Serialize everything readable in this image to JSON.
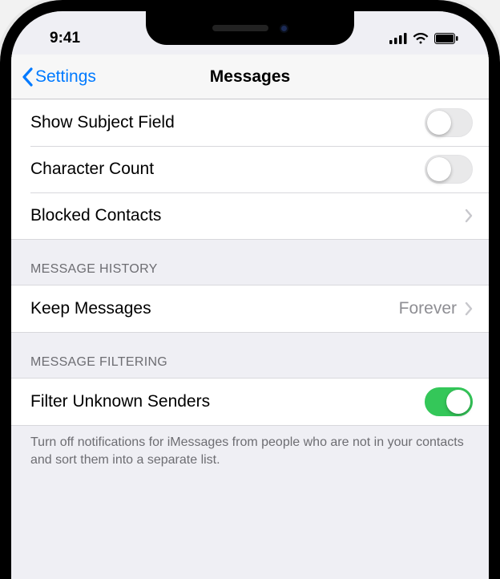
{
  "status": {
    "time": "9:41"
  },
  "nav": {
    "back_label": "Settings",
    "title": "Messages"
  },
  "sections": {
    "general": {
      "show_subject": {
        "label": "Show Subject Field",
        "on": false
      },
      "char_count": {
        "label": "Character Count",
        "on": false
      },
      "blocked": {
        "label": "Blocked Contacts"
      }
    },
    "history": {
      "header": "MESSAGE HISTORY",
      "keep": {
        "label": "Keep Messages",
        "value": "Forever"
      }
    },
    "filtering": {
      "header": "MESSAGE FILTERING",
      "filter_unknown": {
        "label": "Filter Unknown Senders",
        "on": true
      },
      "footer": "Turn off notifications for iMessages from people who are not in your contacts and sort them into a separate list."
    }
  },
  "colors": {
    "tint": "#007aff",
    "switch_on": "#34c759"
  }
}
